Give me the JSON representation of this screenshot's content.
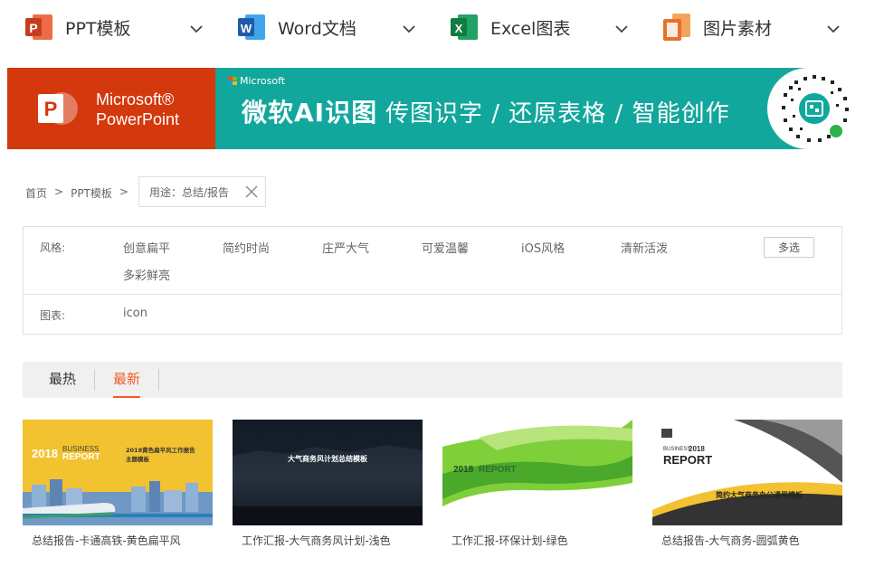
{
  "nav": {
    "items": [
      {
        "label": "PPT模板"
      },
      {
        "label": "Word文档"
      },
      {
        "label": "Excel图表"
      },
      {
        "label": "图片素材"
      }
    ]
  },
  "banner": {
    "ms_line1": "Microsoft®",
    "ms_line2": "PowerPoint",
    "ms_small": "Microsoft",
    "title": "微软AI识图",
    "subtitle": "传图识字 / 还原表格 / 智能创作",
    "accent_color": "#12a79d",
    "brand_color": "#d4380d"
  },
  "breadcrumb": {
    "home": "首页",
    "sep": ">",
    "section": "PPT模板",
    "active_filter": "用途：总结/报告"
  },
  "filters": {
    "style_label": "风格:",
    "style_options": [
      "创意扁平",
      "简约时尚",
      "庄严大气",
      "可爱温馨",
      "iOS风格",
      "清新活泼",
      "多彩鲜亮"
    ],
    "multi_select": "多选",
    "chart_label": "图表:",
    "chart_options": [
      "icon"
    ]
  },
  "tabs": {
    "items": [
      {
        "label": "最热"
      },
      {
        "label": "最新"
      }
    ],
    "active_color": "#f25c27"
  },
  "cards": [
    {
      "caption": "总结报告-卡通高铁-黄色扁平风",
      "thumb_year": "2018",
      "thumb_business": "BUSINESS",
      "thumb_report": "REPORT",
      "thumb_title": "2018黄色扁平风工作报告",
      "thumb_subtitle": "主题模板"
    },
    {
      "caption": "工作汇报-大气商务风计划-浅色",
      "thumb_title": "大气商务风计划总结模板"
    },
    {
      "caption": "工作汇报-环保计划-绿色",
      "thumb_year": "2018",
      "thumb_report": "REPORT"
    },
    {
      "caption": "总结报告-大气商务-圆弧黄色",
      "thumb_business": "BUSINESS",
      "thumb_year": "2018",
      "thumb_report": "REPORT",
      "thumb_title": "简约大气商务办公通用模板"
    }
  ]
}
